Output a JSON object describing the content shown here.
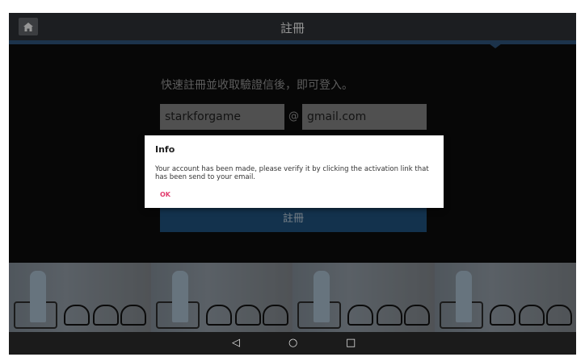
{
  "header": {
    "title": "註冊",
    "home_icon": "home-icon"
  },
  "form": {
    "subtitle": "快速註冊並收取驗證信後，即可登入。",
    "username_value": "starkforgame",
    "at_symbol": "@",
    "domain_value": "gmail.com",
    "register_label": "註冊"
  },
  "dialog": {
    "title": "Info",
    "message": "Your account has been made, please verify it by clicking the activation link that has been send to your email.",
    "ok_label": "OK"
  },
  "navbar": {
    "back": "◁",
    "home": "○",
    "recents": "□"
  },
  "colors": {
    "accent": "#1e4d77",
    "ok": "#e23b6d"
  }
}
